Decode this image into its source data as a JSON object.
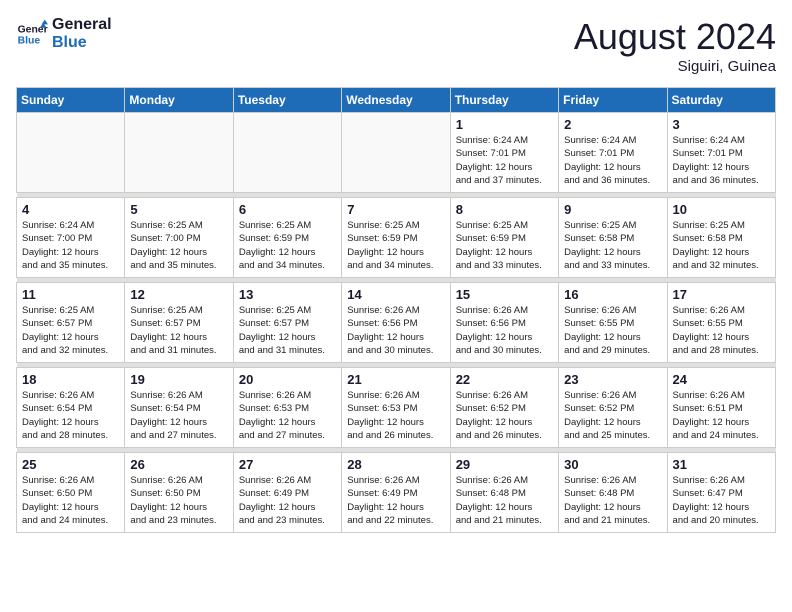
{
  "header": {
    "logo_line1": "General",
    "logo_line2": "Blue",
    "month_title": "August 2024",
    "location": "Siguiri, Guinea"
  },
  "weekdays": [
    "Sunday",
    "Monday",
    "Tuesday",
    "Wednesday",
    "Thursday",
    "Friday",
    "Saturday"
  ],
  "weeks": [
    [
      {
        "day": "",
        "sunrise": "",
        "sunset": "",
        "daylight": ""
      },
      {
        "day": "",
        "sunrise": "",
        "sunset": "",
        "daylight": ""
      },
      {
        "day": "",
        "sunrise": "",
        "sunset": "",
        "daylight": ""
      },
      {
        "day": "",
        "sunrise": "",
        "sunset": "",
        "daylight": ""
      },
      {
        "day": "1",
        "sunrise": "Sunrise: 6:24 AM",
        "sunset": "Sunset: 7:01 PM",
        "daylight": "Daylight: 12 hours and 37 minutes."
      },
      {
        "day": "2",
        "sunrise": "Sunrise: 6:24 AM",
        "sunset": "Sunset: 7:01 PM",
        "daylight": "Daylight: 12 hours and 36 minutes."
      },
      {
        "day": "3",
        "sunrise": "Sunrise: 6:24 AM",
        "sunset": "Sunset: 7:01 PM",
        "daylight": "Daylight: 12 hours and 36 minutes."
      }
    ],
    [
      {
        "day": "4",
        "sunrise": "Sunrise: 6:24 AM",
        "sunset": "Sunset: 7:00 PM",
        "daylight": "Daylight: 12 hours and 35 minutes."
      },
      {
        "day": "5",
        "sunrise": "Sunrise: 6:25 AM",
        "sunset": "Sunset: 7:00 PM",
        "daylight": "Daylight: 12 hours and 35 minutes."
      },
      {
        "day": "6",
        "sunrise": "Sunrise: 6:25 AM",
        "sunset": "Sunset: 6:59 PM",
        "daylight": "Daylight: 12 hours and 34 minutes."
      },
      {
        "day": "7",
        "sunrise": "Sunrise: 6:25 AM",
        "sunset": "Sunset: 6:59 PM",
        "daylight": "Daylight: 12 hours and 34 minutes."
      },
      {
        "day": "8",
        "sunrise": "Sunrise: 6:25 AM",
        "sunset": "Sunset: 6:59 PM",
        "daylight": "Daylight: 12 hours and 33 minutes."
      },
      {
        "day": "9",
        "sunrise": "Sunrise: 6:25 AM",
        "sunset": "Sunset: 6:58 PM",
        "daylight": "Daylight: 12 hours and 33 minutes."
      },
      {
        "day": "10",
        "sunrise": "Sunrise: 6:25 AM",
        "sunset": "Sunset: 6:58 PM",
        "daylight": "Daylight: 12 hours and 32 minutes."
      }
    ],
    [
      {
        "day": "11",
        "sunrise": "Sunrise: 6:25 AM",
        "sunset": "Sunset: 6:57 PM",
        "daylight": "Daylight: 12 hours and 32 minutes."
      },
      {
        "day": "12",
        "sunrise": "Sunrise: 6:25 AM",
        "sunset": "Sunset: 6:57 PM",
        "daylight": "Daylight: 12 hours and 31 minutes."
      },
      {
        "day": "13",
        "sunrise": "Sunrise: 6:25 AM",
        "sunset": "Sunset: 6:57 PM",
        "daylight": "Daylight: 12 hours and 31 minutes."
      },
      {
        "day": "14",
        "sunrise": "Sunrise: 6:26 AM",
        "sunset": "Sunset: 6:56 PM",
        "daylight": "Daylight: 12 hours and 30 minutes."
      },
      {
        "day": "15",
        "sunrise": "Sunrise: 6:26 AM",
        "sunset": "Sunset: 6:56 PM",
        "daylight": "Daylight: 12 hours and 30 minutes."
      },
      {
        "day": "16",
        "sunrise": "Sunrise: 6:26 AM",
        "sunset": "Sunset: 6:55 PM",
        "daylight": "Daylight: 12 hours and 29 minutes."
      },
      {
        "day": "17",
        "sunrise": "Sunrise: 6:26 AM",
        "sunset": "Sunset: 6:55 PM",
        "daylight": "Daylight: 12 hours and 28 minutes."
      }
    ],
    [
      {
        "day": "18",
        "sunrise": "Sunrise: 6:26 AM",
        "sunset": "Sunset: 6:54 PM",
        "daylight": "Daylight: 12 hours and 28 minutes."
      },
      {
        "day": "19",
        "sunrise": "Sunrise: 6:26 AM",
        "sunset": "Sunset: 6:54 PM",
        "daylight": "Daylight: 12 hours and 27 minutes."
      },
      {
        "day": "20",
        "sunrise": "Sunrise: 6:26 AM",
        "sunset": "Sunset: 6:53 PM",
        "daylight": "Daylight: 12 hours and 27 minutes."
      },
      {
        "day": "21",
        "sunrise": "Sunrise: 6:26 AM",
        "sunset": "Sunset: 6:53 PM",
        "daylight": "Daylight: 12 hours and 26 minutes."
      },
      {
        "day": "22",
        "sunrise": "Sunrise: 6:26 AM",
        "sunset": "Sunset: 6:52 PM",
        "daylight": "Daylight: 12 hours and 26 minutes."
      },
      {
        "day": "23",
        "sunrise": "Sunrise: 6:26 AM",
        "sunset": "Sunset: 6:52 PM",
        "daylight": "Daylight: 12 hours and 25 minutes."
      },
      {
        "day": "24",
        "sunrise": "Sunrise: 6:26 AM",
        "sunset": "Sunset: 6:51 PM",
        "daylight": "Daylight: 12 hours and 24 minutes."
      }
    ],
    [
      {
        "day": "25",
        "sunrise": "Sunrise: 6:26 AM",
        "sunset": "Sunset: 6:50 PM",
        "daylight": "Daylight: 12 hours and 24 minutes."
      },
      {
        "day": "26",
        "sunrise": "Sunrise: 6:26 AM",
        "sunset": "Sunset: 6:50 PM",
        "daylight": "Daylight: 12 hours and 23 minutes."
      },
      {
        "day": "27",
        "sunrise": "Sunrise: 6:26 AM",
        "sunset": "Sunset: 6:49 PM",
        "daylight": "Daylight: 12 hours and 23 minutes."
      },
      {
        "day": "28",
        "sunrise": "Sunrise: 6:26 AM",
        "sunset": "Sunset: 6:49 PM",
        "daylight": "Daylight: 12 hours and 22 minutes."
      },
      {
        "day": "29",
        "sunrise": "Sunrise: 6:26 AM",
        "sunset": "Sunset: 6:48 PM",
        "daylight": "Daylight: 12 hours and 21 minutes."
      },
      {
        "day": "30",
        "sunrise": "Sunrise: 6:26 AM",
        "sunset": "Sunset: 6:48 PM",
        "daylight": "Daylight: 12 hours and 21 minutes."
      },
      {
        "day": "31",
        "sunrise": "Sunrise: 6:26 AM",
        "sunset": "Sunset: 6:47 PM",
        "daylight": "Daylight: 12 hours and 20 minutes."
      }
    ]
  ]
}
